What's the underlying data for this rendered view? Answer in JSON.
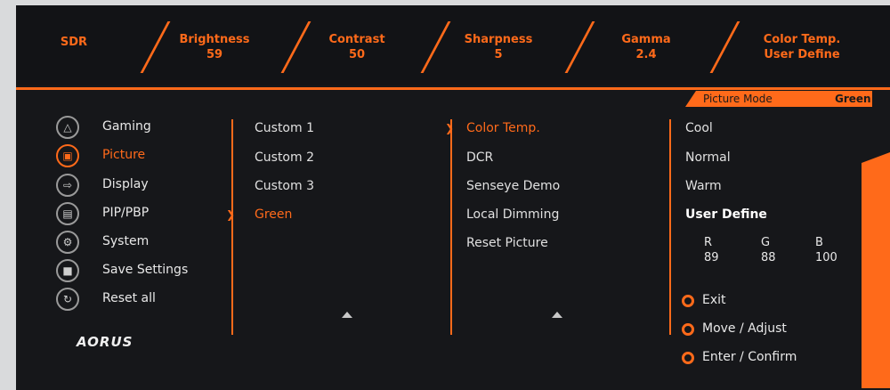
{
  "status_bar": {
    "mode": "SDR",
    "brightness": {
      "label": "Brightness",
      "value": "59"
    },
    "contrast": {
      "label": "Contrast",
      "value": "50"
    },
    "sharpness": {
      "label": "Sharpness",
      "value": "5"
    },
    "gamma": {
      "label": "Gamma",
      "value": "2.4"
    },
    "color_temp": {
      "label": "Color Temp.",
      "value": "User Define"
    }
  },
  "picture_mode": {
    "label": "Picture Mode",
    "value": "Green"
  },
  "main_menu": {
    "items": [
      {
        "label": "Gaming",
        "icon": "gamepad-icon"
      },
      {
        "label": "Picture",
        "icon": "picture-icon"
      },
      {
        "label": "Display",
        "icon": "display-input-icon"
      },
      {
        "label": "PIP/PBP",
        "icon": "pip-icon"
      },
      {
        "label": "System",
        "icon": "gear-icon"
      },
      {
        "label": "Save Settings",
        "icon": "save-icon"
      },
      {
        "label": "Reset all",
        "icon": "reset-icon"
      }
    ],
    "active_index": 1
  },
  "picture_modes": {
    "items": [
      "Custom 1",
      "Custom 2",
      "Custom 3",
      "Green"
    ],
    "active_index": 3
  },
  "picture_settings": {
    "items": [
      "Color Temp.",
      "DCR",
      "Senseye Demo",
      "Local Dimming",
      "Reset Picture"
    ],
    "active_index": 0
  },
  "color_temp_options": {
    "items": [
      "Cool",
      "Normal",
      "Warm",
      "User Define"
    ],
    "selected_index": 3
  },
  "rgb": {
    "r": {
      "label": "R",
      "value": "89"
    },
    "g": {
      "label": "G",
      "value": "88"
    },
    "b": {
      "label": "B",
      "value": "100"
    }
  },
  "logo": "AORUS",
  "hints": {
    "exit": "Exit",
    "move": "Move  / Adjust",
    "enter": "Enter  / Confirm"
  },
  "colors": {
    "accent": "#ff6a1a",
    "background": "#16171a"
  }
}
